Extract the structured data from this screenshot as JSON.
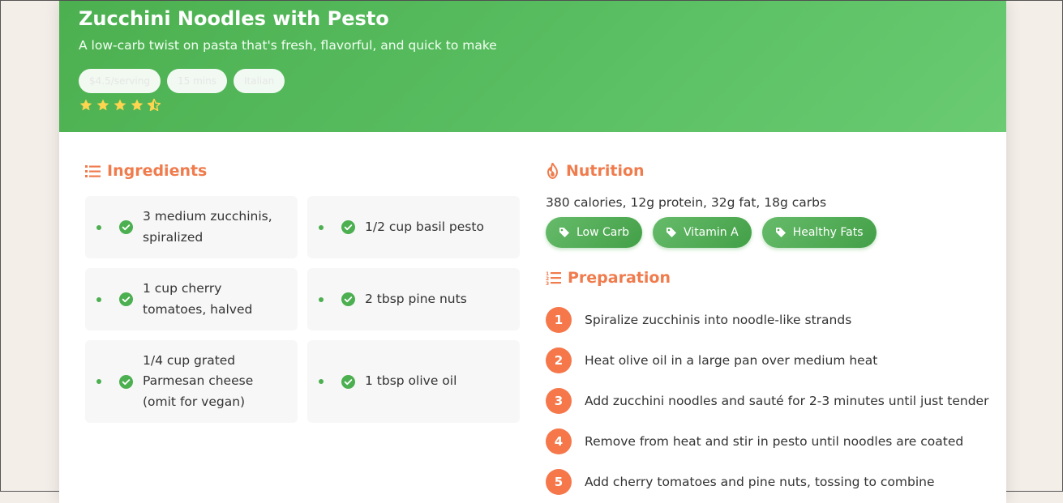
{
  "recipe": {
    "title": "Zucchini Noodles with Pesto",
    "subtitle": "A low-carb twist on pasta that's fresh, flavorful, and quick to make",
    "tags": [
      "$4.5/serving",
      "15 mins",
      "Italian"
    ],
    "rating": 4.5
  },
  "ingredients": {
    "heading": "Ingredients",
    "items": [
      "3 medium zucchinis, spiralized",
      "1/2 cup basil pesto",
      "1 cup cherry tomatoes, halved",
      "2 tbsp pine nuts",
      "1/4 cup grated Parmesan cheese (omit for vegan)",
      "1 tbsp olive oil"
    ]
  },
  "nutrition": {
    "heading": "Nutrition",
    "summary": "380 calories, 12g protein, 32g fat, 18g carbs",
    "badges": [
      "Low Carb",
      "Vitamin A",
      "Healthy Fats"
    ]
  },
  "preparation": {
    "heading": "Preparation",
    "steps": [
      {
        "num": "1",
        "text": "Spiralize zucchinis into noodle-like strands"
      },
      {
        "num": "2",
        "text": "Heat olive oil in a large pan over medium heat"
      },
      {
        "num": "3",
        "text": "Add zucchini noodles and sauté for 2-3 minutes until just tender"
      },
      {
        "num": "4",
        "text": "Remove from heat and stir in pesto until noodles are coated"
      },
      {
        "num": "5",
        "text": "Add cherry tomatoes and pine nuts, tossing to combine"
      }
    ]
  },
  "icons": {
    "star": "star-icon",
    "half_star": "half-star-icon",
    "list": "list-icon",
    "fire": "fire-icon",
    "tag": "tag-icon",
    "check": "check-circle-icon",
    "ordered_list": "ordered-list-icon"
  },
  "colors": {
    "header_green": "#4cb050",
    "accent_orange": "#f07b4c",
    "badge_green": "#43a047",
    "star_yellow": "#ffd54f"
  }
}
